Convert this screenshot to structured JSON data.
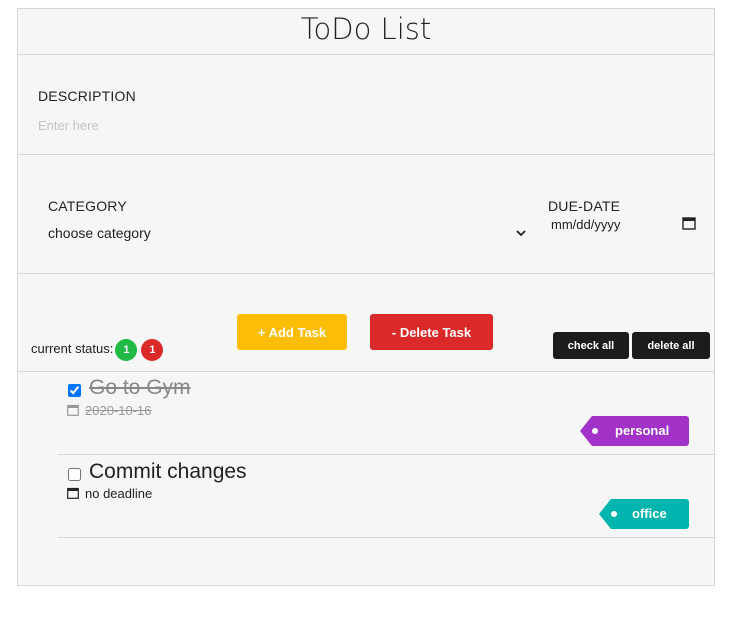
{
  "header": {
    "title": "ToDo List"
  },
  "description": {
    "label": "DESCRIPTION",
    "placeholder": "Enter here",
    "value": ""
  },
  "category": {
    "label": "CATEGORY",
    "selected": "choose category"
  },
  "due_date": {
    "label": "DUE-DATE",
    "value": "mm/dd/yyyy"
  },
  "status": {
    "label": "current status:",
    "completed_count": "1",
    "pending_count": "1"
  },
  "buttons": {
    "add": "+ Add Task",
    "delete": "- Delete Task",
    "check_all": "check all",
    "delete_all": "delete all"
  },
  "tasks": [
    {
      "name": "Go to Gym",
      "date": "2020-10-16",
      "category": "personal",
      "checked": true,
      "color": "#a333c8"
    },
    {
      "name": "Commit changes",
      "date": "no deadline",
      "category": "office",
      "checked": false,
      "color": "#00b5ad"
    }
  ],
  "colors": {
    "green": "#21ba45",
    "red": "#db2828",
    "yellow": "#fbbd08",
    "dark": "#1b1c1d"
  }
}
